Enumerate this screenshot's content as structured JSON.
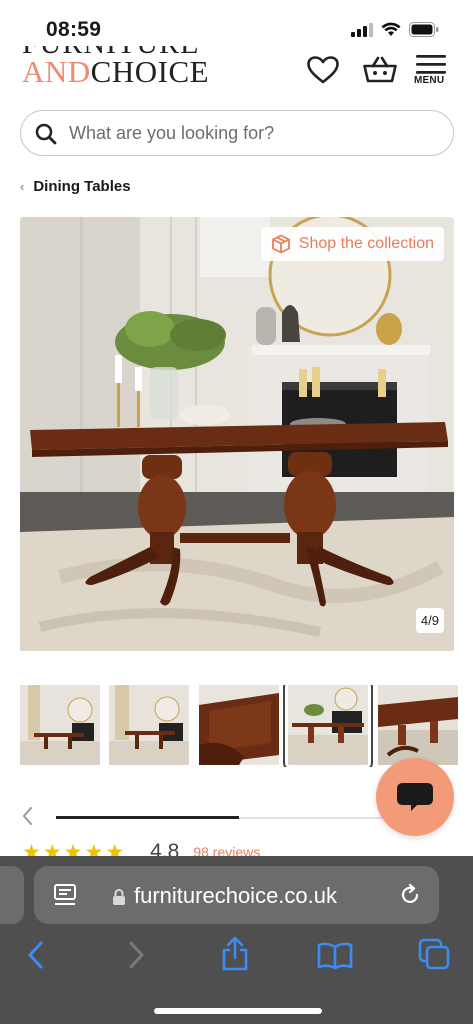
{
  "status_bar": {
    "time": "08:59"
  },
  "header": {
    "logo_top": "FURNITURE",
    "logo_and": "AND",
    "logo_choice": "CHOICE",
    "menu_label": "MENU"
  },
  "search": {
    "placeholder": "What are you looking for?"
  },
  "breadcrumb": {
    "label": "Dining Tables"
  },
  "gallery": {
    "shop_collection_label": "Shop the collection",
    "counter": "4/9",
    "thumbnail_count": 5,
    "active_thumbnail": 4,
    "carousel_progress_percent": 47
  },
  "rating": {
    "value": "4.8",
    "reviews": "98 reviews"
  },
  "browser": {
    "url": "furniturechoice.co.uk"
  },
  "colors": {
    "brand_accent": "#f08a6e",
    "link_accent": "#e77d5f",
    "chat_button": "#f39b78",
    "star": "#f2c200",
    "ios_blue": "#3c8cf5",
    "browser_bar": "#4f4f4f"
  },
  "icons": {
    "signal": "cellular-signal-icon",
    "wifi": "wifi-icon",
    "battery": "battery-icon",
    "wishlist": "heart-icon",
    "basket": "basket-icon",
    "menu": "hamburger-menu-icon",
    "search": "search-icon",
    "breadcrumb": "chevron-left-icon",
    "shop": "box-icon",
    "chat": "chat-bubble-icon",
    "reader": "reader-mode-icon",
    "lock": "lock-icon",
    "reload": "reload-icon",
    "back": "back-arrow-icon",
    "forward": "forward-arrow-icon",
    "share": "share-icon",
    "bookmarks": "book-icon",
    "tabs": "tabs-icon"
  }
}
